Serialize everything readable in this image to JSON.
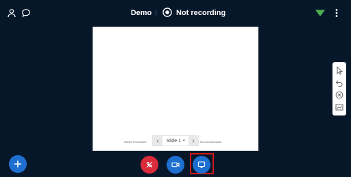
{
  "header": {
    "meeting_title": "Demo",
    "recording_status": "Not recording",
    "user_list_icon": "user-icon",
    "chat_icon": "chat-icon",
    "record_icon": "record-icon",
    "connection_icon": "signal-icon",
    "options_icon": "more-vertical-icon"
  },
  "presentation": {
    "slide_label": "Slide 1",
    "footer_left": "Sample Presentation",
    "footer_right": "bbb.com/downloads",
    "prev_glyph": "‹",
    "next_glyph": "›",
    "caret_glyph": "▾"
  },
  "whiteboard_tools": [
    {
      "icon": "pointer-icon"
    },
    {
      "icon": "undo-icon"
    },
    {
      "icon": "clear-icon"
    },
    {
      "icon": "multi-user-icon"
    }
  ],
  "actions": {
    "actions_icon": "plus-icon",
    "audio_icon": "mute-icon",
    "video_icon": "video-icon",
    "screenshare_icon": "screenshare-icon"
  },
  "colors": {
    "background": "#06172a",
    "primary": "#1e6fd0",
    "danger": "#d92b3a",
    "connection": "#4caf50",
    "highlight": "#d21a1a"
  }
}
